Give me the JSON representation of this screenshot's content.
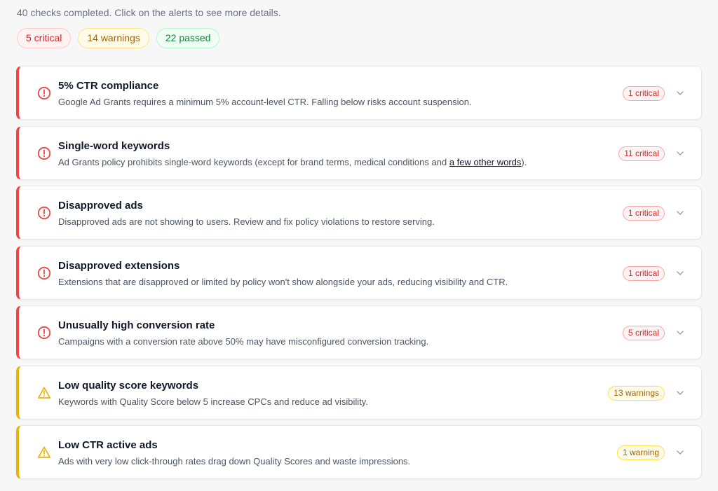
{
  "summary": {
    "text": "40 checks completed. Click on the alerts to see more details.",
    "critical_label": "5 critical",
    "warnings_label": "14 warnings",
    "passed_label": "22 passed"
  },
  "colors": {
    "critical": "#ef4444",
    "warning": "#eab308",
    "passed": "#15803d"
  },
  "alerts": [
    {
      "title": "5% CTR compliance",
      "description": "Google Ad Grants requires a minimum 5% account-level CTR. Falling below risks account suspension.",
      "badge": "1 critical",
      "severity": "critical",
      "icon": "alert-circle-icon"
    },
    {
      "title": "Single-word keywords",
      "description_before": "Ad Grants policy prohibits single-word keywords (except for brand terms, medical conditions and ",
      "description_link": "a few other words",
      "description_after": ").",
      "badge": "11 critical",
      "severity": "critical",
      "icon": "alert-circle-icon"
    },
    {
      "title": "Disapproved ads",
      "description": "Disapproved ads are not showing to users. Review and fix policy violations to restore serving.",
      "badge": "1 critical",
      "severity": "critical",
      "icon": "alert-circle-icon"
    },
    {
      "title": "Disapproved extensions",
      "description": "Extensions that are disapproved or limited by policy won't show alongside your ads, reducing visibility and CTR.",
      "badge": "1 critical",
      "severity": "critical",
      "icon": "alert-circle-icon"
    },
    {
      "title": "Unusually high conversion rate",
      "description": "Campaigns with a conversion rate above 50% may have misconfigured conversion tracking.",
      "badge": "5 critical",
      "severity": "critical",
      "icon": "alert-circle-icon"
    },
    {
      "title": "Low quality score keywords",
      "description": "Keywords with Quality Score below 5 increase CPCs and reduce ad visibility.",
      "badge": "13 warnings",
      "severity": "warning",
      "icon": "warning-triangle-icon"
    },
    {
      "title": "Low CTR active ads",
      "description": "Ads with very low click-through rates drag down Quality Scores and waste impressions.",
      "badge": "1 warning",
      "severity": "warning",
      "icon": "warning-triangle-icon"
    }
  ]
}
